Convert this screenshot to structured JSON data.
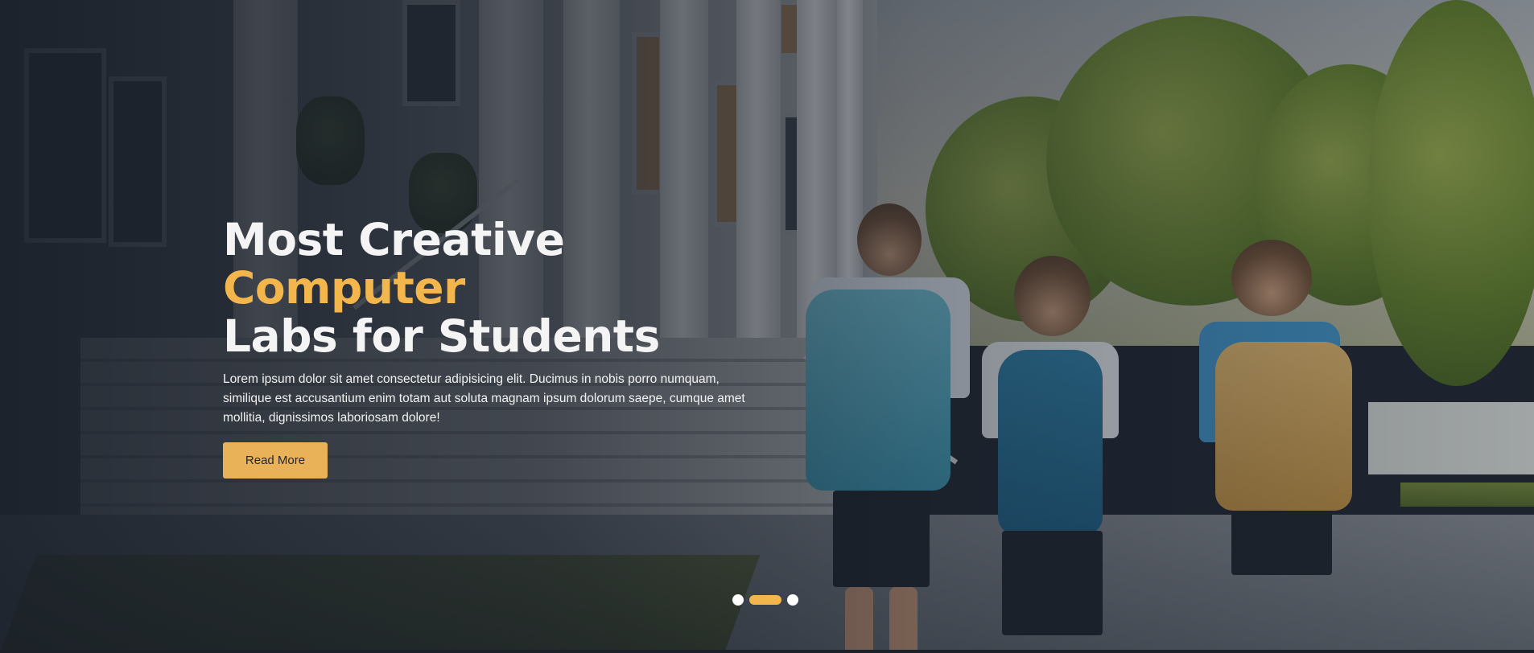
{
  "hero": {
    "title_part1": "Most Creative ",
    "title_accent": "Computer",
    "title_part2": "Labs for Students",
    "description": "Lorem ipsum dolor sit amet consectetur adipisicing elit. Ducimus in nobis porro numquam, similique est accusantium enim totam aut soluta magnam ipsum dolorum saepe, cumque amet mollitia, dignissimos laboriosam dolore!",
    "button_label": "Read More"
  },
  "slider": {
    "slide_count": 3,
    "active_slide": 2
  },
  "colors": {
    "accent": "#f3b64d",
    "button_bg": "#e9b259",
    "text": "#f4f4f4"
  }
}
